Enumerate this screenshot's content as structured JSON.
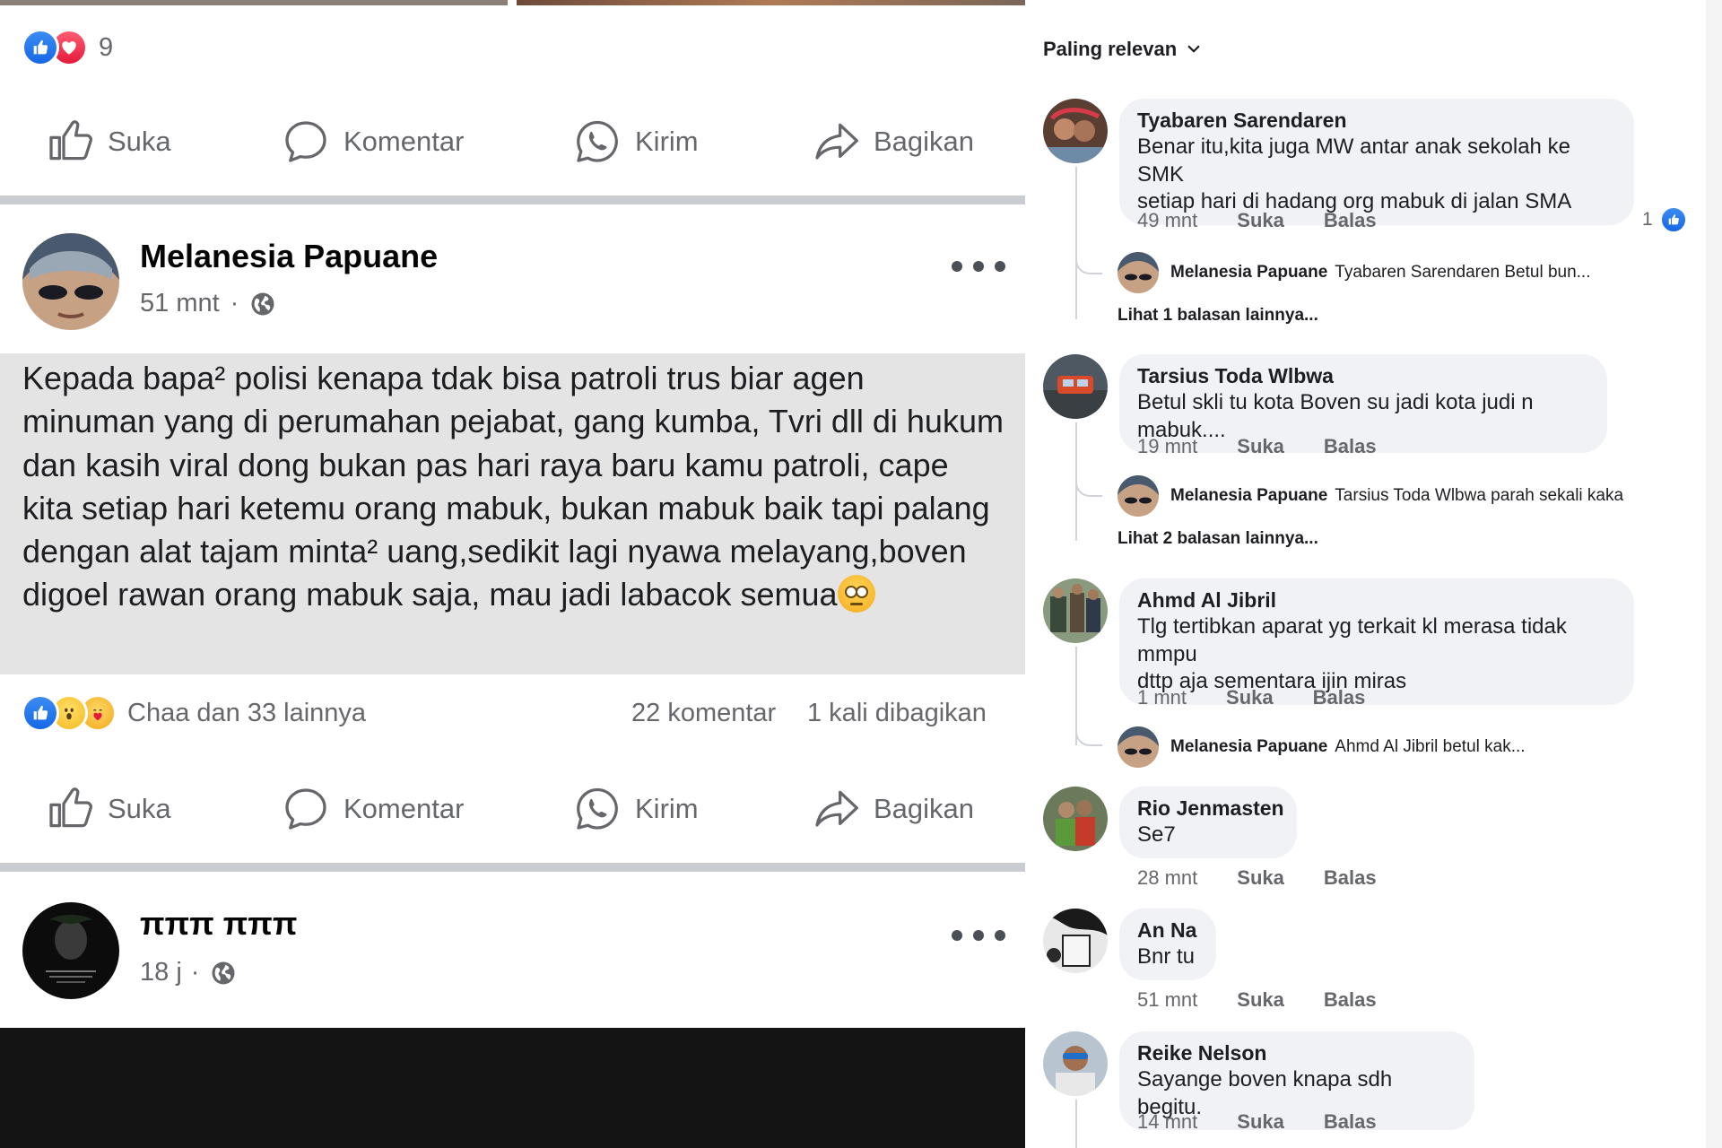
{
  "prev_post": {
    "reaction_count": "9",
    "actions": {
      "like": "Suka",
      "comment": "Komentar",
      "send": "Kirim",
      "share": "Bagikan"
    }
  },
  "post": {
    "author": "Melanesia Papuane",
    "time": "51 mnt",
    "separator": "·",
    "body": "Kepada bapa² polisi kenapa tdak bisa patroli trus biar agen minuman yang di perumahan pejabat, gang kumba, Tvri dll di hukum dan kasih viral dong bukan pas hari raya baru kamu patroli, cape kita setiap hari ketemu orang mabuk, bukan mabuk baik tapi palang dengan alat tajam minta² uang,sedikit lagi nyawa melayang,boven digoel rawan orang mabuk saja, mau jadi labacok semua",
    "reactions_text": "Chaa dan 33 lainnya",
    "comments_count": "22 komentar",
    "shares_count": "1 kali dibagikan",
    "actions": {
      "like": "Suka",
      "comment": "Komentar",
      "send": "Kirim",
      "share": "Bagikan"
    }
  },
  "next_post": {
    "author": "πππ πππ",
    "time": "18 j",
    "separator": "·"
  },
  "comments_panel": {
    "sort_label": "Paling relevan",
    "like_label": "Suka",
    "reply_label": "Balas",
    "comments": [
      {
        "name": "Tyabaren Sarendaren",
        "text_lines": [
          "Benar itu,kita juga MW antar anak sekolah ke SMK",
          "setiap hari di hadang org mabuk di jalan SMA"
        ],
        "time": "49 mnt",
        "likes": "1",
        "reply": {
          "name": "Melanesia Papuane",
          "text": "Tyabaren Sarendaren Betul bun..."
        },
        "more_replies": "Lihat 1 balasan lainnya..."
      },
      {
        "name": "Tarsius Toda Wlbwa",
        "text_lines": [
          "Betul skli tu kota Boven su jadi kota judi n mabuk...."
        ],
        "time": "19 mnt",
        "reply": {
          "name": "Melanesia Papuane",
          "text": "Tarsius Toda Wlbwa parah sekali kaka"
        },
        "more_replies": "Lihat 2 balasan lainnya..."
      },
      {
        "name": "Ahmd Al Jibril",
        "text_lines": [
          "Tlg tertibkan aparat yg terkait kl merasa tidak mmpu",
          "dttp aja sementara ijin miras"
        ],
        "time": "1 mnt",
        "reply": {
          "name": "Melanesia Papuane",
          "text": "Ahmd Al Jibril betul kak..."
        }
      },
      {
        "name": "Rio Jenmasten",
        "text_lines": [
          "Se7"
        ],
        "time": "28 mnt"
      },
      {
        "name": "An Na",
        "text_lines": [
          "Bnr tu"
        ],
        "time": "51 mnt"
      },
      {
        "name": "Reike Nelson",
        "text_lines": [
          "Sayange boven knapa sdh begitu."
        ],
        "time": "14 mnt"
      }
    ]
  },
  "colors": {
    "secondary_text": "#65676b",
    "like_blue": "#1877f2",
    "bubble": "#f0f2f5",
    "post_bg": "#e4e4e4"
  },
  "icons": [
    "like-icon",
    "heart-icon",
    "wow-icon",
    "care-icon",
    "thumbs-up-icon",
    "comment-icon",
    "whatsapp-icon",
    "share-icon",
    "globe-icon",
    "more-icon",
    "chevron-down-icon"
  ]
}
